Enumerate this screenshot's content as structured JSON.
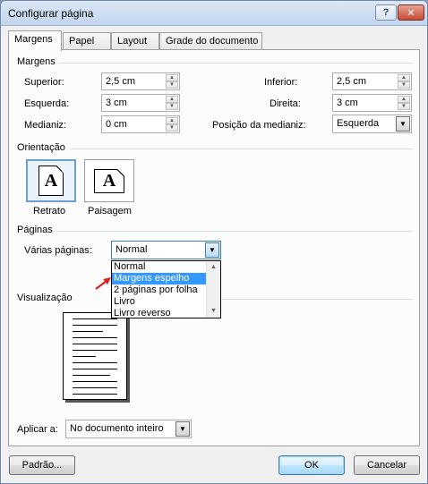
{
  "window": {
    "title": "Configurar página",
    "help_glyph": "?",
    "close_glyph": "✕"
  },
  "tabs": [
    "Margens",
    "Papel",
    "Layout",
    "Grade do documento"
  ],
  "margins": {
    "section": "Margens",
    "superior_label": "Superior:",
    "superior_value": "2,5 cm",
    "inferior_label": "Inferior:",
    "inferior_value": "2,5 cm",
    "esquerda_label": "Esquerda:",
    "esquerda_value": "3 cm",
    "direita_label": "Direita:",
    "direita_value": "3 cm",
    "medianiz_label": "Medianiz:",
    "medianiz_value": "0 cm",
    "posicao_label": "Posição da medianiz:",
    "posicao_value": "Esquerda"
  },
  "orientation": {
    "section": "Orientação",
    "icon_letter": "A",
    "retrato": "Retrato",
    "paisagem": "Paisagem",
    "selected": "Retrato"
  },
  "pages": {
    "section": "Páginas",
    "varias_label": "Várias páginas:",
    "varias_value": "Normal",
    "options": [
      "Normal",
      "Margens espelho",
      "2 páginas por folha",
      "Livro",
      "Livro reverso"
    ],
    "highlighted": "Margens espelho"
  },
  "preview": {
    "section": "Visualização"
  },
  "apply": {
    "label": "Aplicar a:",
    "value": "No documento inteiro"
  },
  "buttons": {
    "padrao": "Padrão...",
    "ok": "OK",
    "cancelar": "Cancelar"
  },
  "colors": {
    "highlight": "#3399ff",
    "arrow": "#e02020"
  }
}
